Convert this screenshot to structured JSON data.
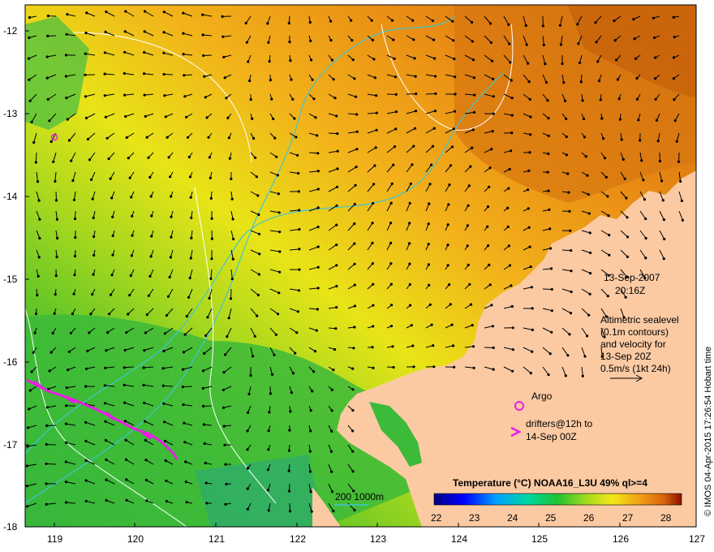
{
  "map": {
    "date_line": "13-Sep-2007",
    "time_line": "20:16Z",
    "altimetry_lines": [
      "Altimetric sealevel",
      "(0.1m contours)",
      "and velocity for",
      "13-Sep 20Z",
      "0.5m/s (1kt 24h)"
    ],
    "argo_label": "Argo",
    "drifters_lines": [
      "drifters@12h to",
      "14-Sep 00Z"
    ],
    "isobath_label": "200  1000m",
    "colorbar_title": "Temperature (°C) NOAA16_L3U 49% ql>=4",
    "colorbar_ticks": [
      "22",
      "23",
      "24",
      "25",
      "26",
      "27",
      "28"
    ],
    "credit": "© IMOS 04-Apr-2015 17:26:54 Hobart time",
    "lat_ticks": [
      "-12",
      "-13",
      "-14",
      "-15",
      "-16",
      "-17",
      "-18"
    ],
    "lon_ticks": [
      "119",
      "120",
      "121",
      "122",
      "123",
      "124",
      "125",
      "126",
      "127"
    ],
    "colors": {
      "land": "#fbcaa3",
      "isobath": "#3fc6d0",
      "contour": "#ffffff",
      "argo": "#e91ee6",
      "drifter": "#e91ee6",
      "arrow": "#000000"
    }
  }
}
